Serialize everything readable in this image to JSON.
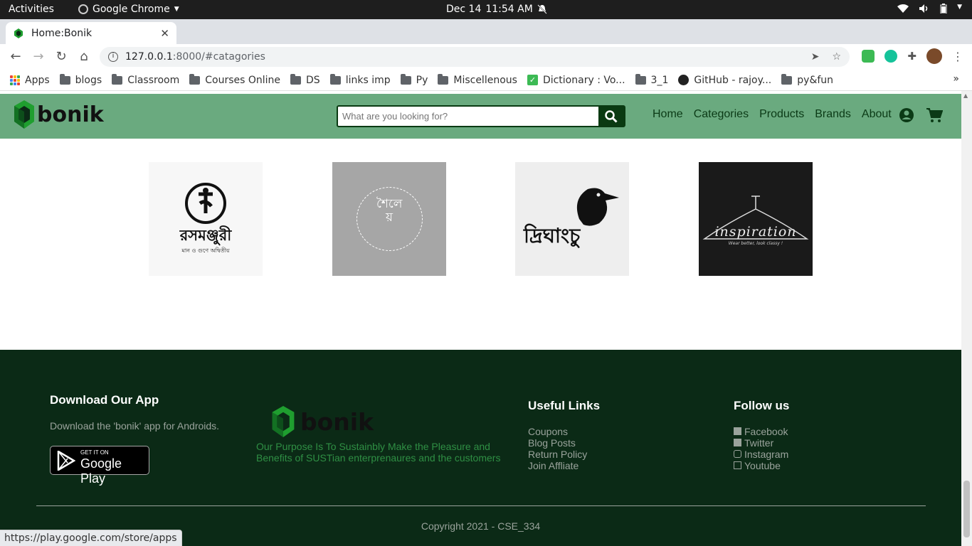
{
  "system_bar": {
    "activities": "Activities",
    "app_name": "Google Chrome",
    "date": "Dec 14",
    "time": "11:54 AM"
  },
  "browser": {
    "tab_title": "Home:Bonik",
    "url_host": "127.0.0.1",
    "url_path": ":8000/#catagories",
    "bookmarks": [
      "Apps",
      "blogs",
      "Classroom",
      "Courses Online",
      "DS",
      "links imp",
      "Py",
      "Miscellenous",
      "Dictionary : Vo...",
      "3_1",
      "GitHub - rajoy...",
      "py&fun"
    ],
    "status_url": "https://play.google.com/store/apps"
  },
  "header": {
    "logo_text": "bonik",
    "search_placeholder": "What are you looking for?",
    "nav": [
      "Home",
      "Categories",
      "Products",
      "Brands",
      "About"
    ]
  },
  "brands": [
    {
      "name": "রসমঞ্জুরী",
      "sub": "মান ও গুণে অদ্বিতীয়",
      "bg": "#f7f7f7"
    },
    {
      "name": "শৈলেয়",
      "bg": "#a6a6a6"
    },
    {
      "name": "দ্রিঘাংচু",
      "bg": "#eeeeee"
    },
    {
      "name": "inspiration",
      "sub": "Wear better, look classy !",
      "bg": "#1a1a1a"
    }
  ],
  "footer": {
    "download_title": "Download Our App",
    "download_text": "Download the 'bonik' app for Androids.",
    "gplay_small": "GET IT ON",
    "gplay_big": "Google Play",
    "logo_text": "bonik",
    "purpose_line1": "Our Purpose Is To Sustainbly Make the Pleasure and",
    "purpose_line2": "Benefits of SUSTian enterprenaures and the customers",
    "links_title": "Useful Links",
    "links": [
      "Coupons",
      "Blog Posts",
      "Return Policy",
      "Join Affliate"
    ],
    "follow_title": "Follow us",
    "follow": [
      "Facebook",
      "Twitter",
      "Instagram",
      "Youtube"
    ],
    "copyright": "Copyright 2021 - CSE_334"
  },
  "colors": {
    "header_green": "#6aaa7f",
    "footer_dark": "#0b2a16",
    "logo_green": "#1f9e2f"
  }
}
